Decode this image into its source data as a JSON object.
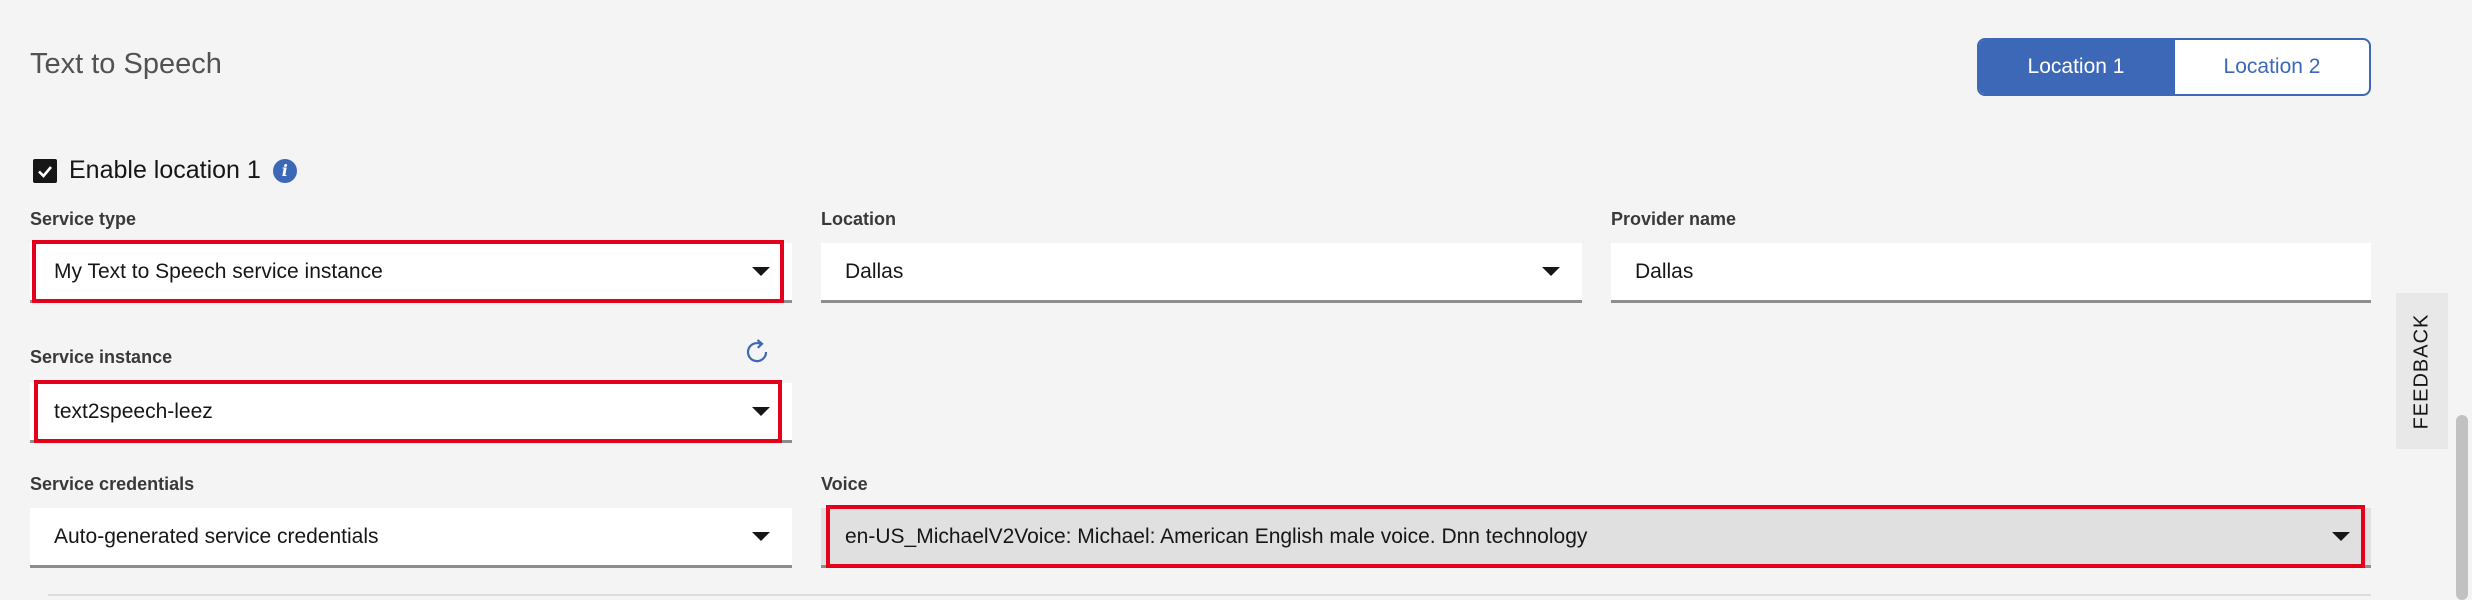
{
  "header": {
    "title": "Text to Speech",
    "locations": [
      "Location 1",
      "Location 2"
    ],
    "active_location": "Location 1"
  },
  "enable": {
    "label": "Enable location 1",
    "checked": true,
    "info_icon": "info-icon"
  },
  "fields": {
    "service_type": {
      "label": "Service type",
      "value": "My Text to Speech service instance"
    },
    "location": {
      "label": "Location",
      "value": "Dallas"
    },
    "provider_name": {
      "label": "Provider name",
      "value": "Dallas"
    },
    "service_instance": {
      "label": "Service instance",
      "value": "text2speech-leez"
    },
    "service_credentials": {
      "label": "Service credentials",
      "value": "Auto-generated service credentials"
    },
    "voice": {
      "label": "Voice",
      "value": "en-US_MichaelV2Voice: Michael: American English male voice. Dnn technology"
    }
  },
  "feedback": {
    "label": "FEEDBACK"
  },
  "colors": {
    "accent": "#3d68b8",
    "highlight": "#e3001b",
    "background": "#f4f4f4"
  }
}
